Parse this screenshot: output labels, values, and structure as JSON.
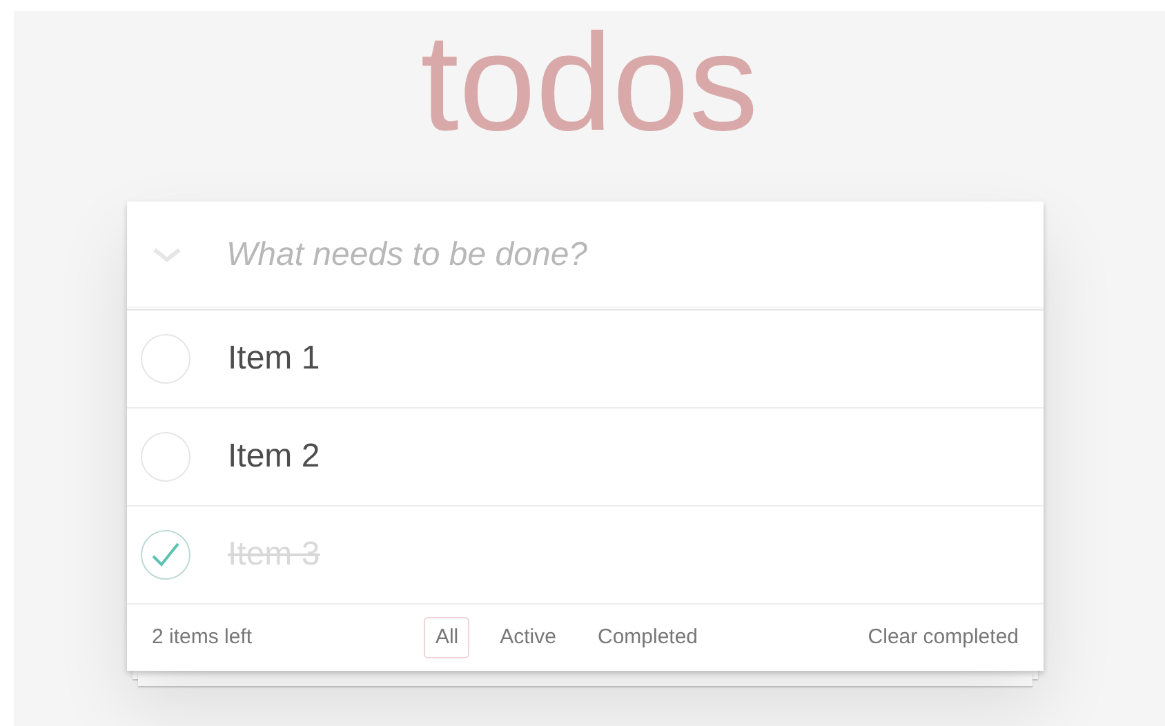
{
  "title": "todos",
  "new_todo": {
    "placeholder": "What needs to be done?"
  },
  "todos": [
    {
      "label": "Item 1",
      "completed": false
    },
    {
      "label": "Item 2",
      "completed": false
    },
    {
      "label": "Item 3",
      "completed": true
    }
  ],
  "footer": {
    "count": "2 items left",
    "filters": [
      {
        "label": "All",
        "selected": true
      },
      {
        "label": "Active",
        "selected": false
      },
      {
        "label": "Completed",
        "selected": false
      }
    ],
    "clear": "Clear completed"
  }
}
